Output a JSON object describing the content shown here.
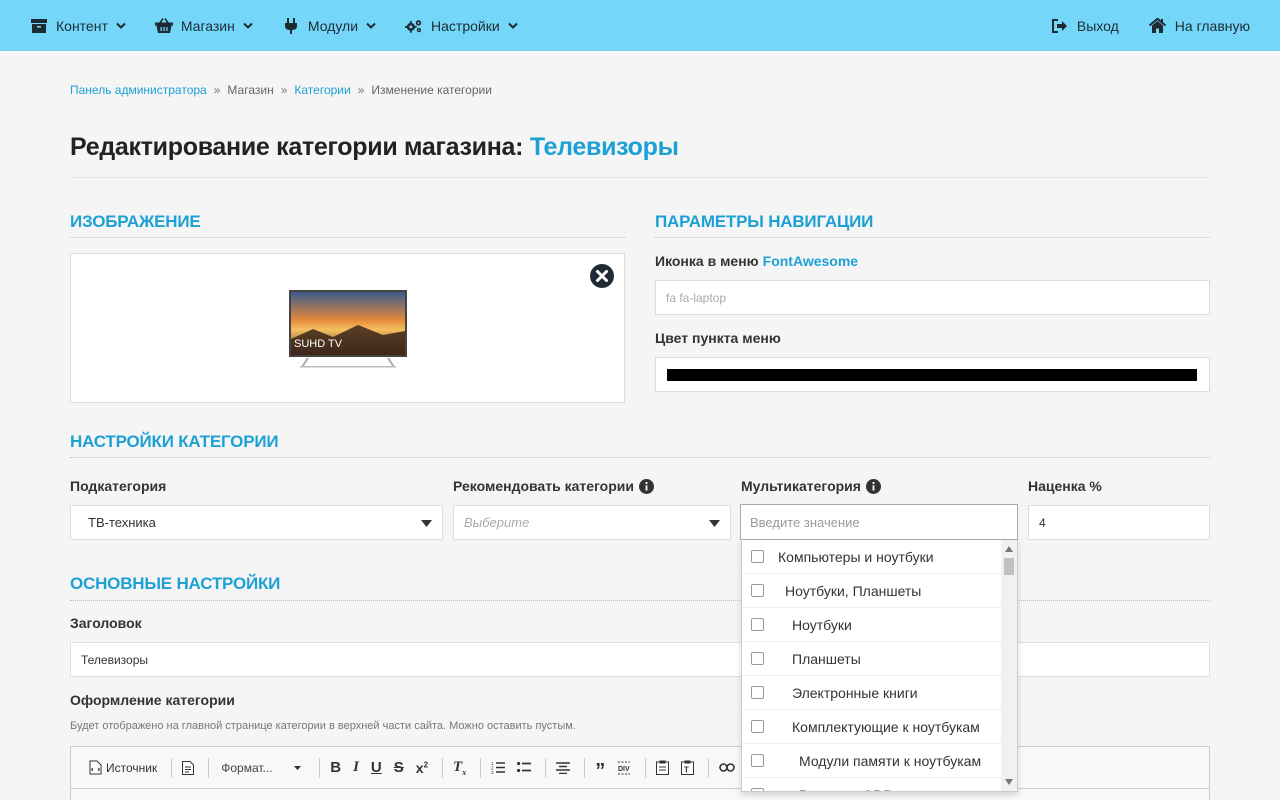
{
  "topbar": {
    "nav": [
      {
        "label": "Контент",
        "icon": "archive-icon"
      },
      {
        "label": "Магазин",
        "icon": "basket-icon"
      },
      {
        "label": "Модули",
        "icon": "plug-icon"
      },
      {
        "label": "Настройки",
        "icon": "cogs-icon"
      }
    ],
    "right": [
      {
        "label": "Выход",
        "icon": "sign-out-icon"
      },
      {
        "label": "На главную",
        "icon": "home-icon"
      }
    ]
  },
  "breadcrumb": {
    "items": [
      "Панель администратора",
      "Магазин",
      "Категории",
      "Изменение категории"
    ],
    "separator": "»"
  },
  "page": {
    "title_prefix": "Редактирование категории магазина:",
    "title_accent": "Телевизоры"
  },
  "image_section": {
    "heading": "ИЗОБРАЖЕНИЕ",
    "tv_brand_text": "SUHD TV"
  },
  "nav_params": {
    "heading": "ПАРАМЕТРЫ НАВИГАЦИИ",
    "icon_label": "Иконка в меню",
    "icon_link": "FontAwesome",
    "icon_placeholder": "fa fa-laptop",
    "color_label": "Цвет пункта меню",
    "color_value": "#000000"
  },
  "category_settings": {
    "heading": "НАСТРОЙКИ КАТЕГОРИИ",
    "subcategory_label": "Подкатегория",
    "subcategory_value": "ТВ-техника",
    "recommend_label": "Рекомендовать категории",
    "recommend_placeholder": "Выберите",
    "multicategory_label": "Мультикатегория",
    "multicategory_search_placeholder": "Введите значение",
    "markup_label": "Наценка %",
    "markup_value": "4",
    "multicategory_options": [
      {
        "label": "Компьютеры и ноутбуки",
        "level": 0
      },
      {
        "label": "Ноутбуки, Планшеты",
        "level": 1
      },
      {
        "label": "Ноутбуки",
        "level": 2
      },
      {
        "label": "Планшеты",
        "level": 2
      },
      {
        "label": "Электронные книги",
        "level": 2
      },
      {
        "label": "Комплектующие к ноутбукам",
        "level": 2
      },
      {
        "label": "Модули памяти к ноутбукам",
        "level": 3
      },
      {
        "label": "Внешние ODD",
        "level": 3
      }
    ]
  },
  "main_settings": {
    "heading": "ОСНОВНЫЕ НАСТРОЙКИ",
    "title_label": "Заголовок",
    "title_value": "Телевизоры",
    "design_label": "Оформление категории",
    "design_note": "Будет отображено на главной странице категории в верхней части сайта. Можно оставить пустым."
  },
  "editor": {
    "source_label": "Источник",
    "format_label": "Формат..."
  },
  "colors": {
    "topbar": "#74d7fa",
    "accent": "#1da1d4"
  }
}
